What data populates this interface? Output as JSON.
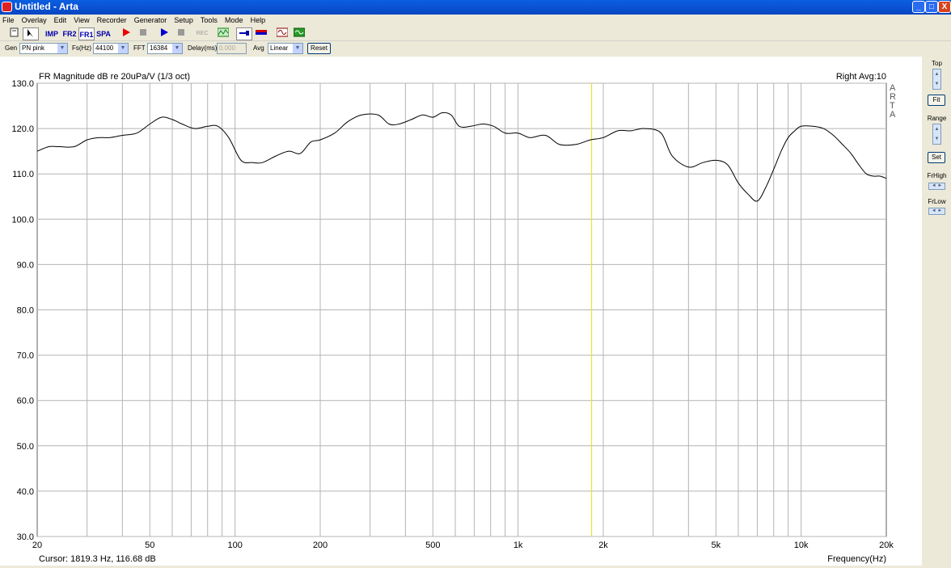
{
  "window": {
    "title": "Untitled - Arta",
    "minimize": "_",
    "maximize": "□",
    "close": "X"
  },
  "menu": [
    "File",
    "Overlay",
    "Edit",
    "View",
    "Recorder",
    "Generator",
    "Setup",
    "Tools",
    "Mode",
    "Help"
  ],
  "toolbar": {
    "imp": "IMP",
    "fr2": "FR2",
    "fr1": "FR1",
    "spa": "SPA",
    "rec": "REC"
  },
  "controls": {
    "gen_label": "Gen",
    "gen_value": "PN pink",
    "fs_label": "Fs(Hz)",
    "fs_value": "44100",
    "fft_label": "FFT",
    "fft_value": "16384",
    "delay_label": "Delay(ms)",
    "delay_value": "0.000",
    "avg_label": "Avg",
    "avg_value": "Linear",
    "reset": "Reset"
  },
  "graph": {
    "title": "FR Magnitude dB re 20uPa/V (1/3 oct)",
    "channel": "Right  Avg:10",
    "watermark": "ARTA",
    "cursor": "Cursor:  1819.3 Hz, 116.68 dB",
    "xlabel": "Frequency(Hz)",
    "line_color": "#000000",
    "cursor_color": "#e6e600",
    "grid_color": "#b4b4b4"
  },
  "rightpanel": {
    "top": "Top",
    "fit": "Fit",
    "range": "Range",
    "set": "Set",
    "frhigh": "FrHigh",
    "frlow": "FrLow"
  },
  "chart_data": {
    "type": "line",
    "x_scale": "log",
    "xlim": [
      20,
      20000
    ],
    "ylim": [
      30,
      130
    ],
    "yticks": [
      130,
      120,
      110,
      100,
      90,
      80,
      70,
      60,
      50,
      40,
      30
    ],
    "ytick_labels": [
      "130.0",
      "120.0",
      "110.0",
      "100.0",
      "90.0",
      "80.0",
      "70.0",
      "60.0",
      "50.0",
      "40.0",
      "30.0"
    ],
    "xtick_values": [
      20,
      50,
      100,
      200,
      500,
      1000,
      2000,
      5000,
      10000,
      20000
    ],
    "xtick_labels": [
      "20",
      "50",
      "100",
      "200",
      "500",
      "1k",
      "2k",
      "5k",
      "10k",
      "20k"
    ],
    "cursor_x": 1819.3,
    "series": [
      {
        "x": [
          20,
          22,
          24,
          27,
          30,
          33,
          36,
          40,
          45,
          50,
          55,
          60,
          65,
          72,
          80,
          87,
          95,
          105,
          115,
          125,
          140,
          155,
          170,
          185,
          200,
          225,
          250,
          280,
          320,
          350,
          380,
          420,
          460,
          500,
          540,
          580,
          620,
          680,
          750,
          820,
          900,
          1000,
          1100,
          1250,
          1400,
          1600,
          1800,
          2000,
          2250,
          2500,
          2800,
          3200,
          3500,
          4000,
          4500,
          5000,
          5500,
          6000,
          6500,
          7000,
          7500,
          8000,
          8500,
          9000,
          9500,
          10000,
          11000,
          12000,
          13000,
          14000,
          15000,
          16000,
          17000,
          18000,
          19000,
          20000
        ],
        "y": [
          115,
          116,
          116,
          116,
          117.5,
          118,
          118,
          118.5,
          119,
          121,
          122.5,
          122,
          121,
          120,
          120.5,
          120.5,
          118,
          113,
          112.5,
          112.5,
          114,
          115,
          114.5,
          117,
          117.5,
          119,
          121.5,
          123,
          123,
          121,
          121,
          122,
          123,
          122.5,
          123.5,
          123,
          120.5,
          120.5,
          121,
          120.5,
          119,
          119,
          118,
          118.5,
          116.5,
          116.5,
          117.5,
          118,
          119.5,
          119.5,
          120,
          119,
          114,
          111.5,
          112.5,
          113,
          112,
          108,
          105.5,
          104,
          107,
          111,
          115,
          118,
          119.5,
          120.5,
          120.5,
          120,
          118.5,
          116.5,
          114.5,
          112,
          110,
          109.5,
          109.5,
          109
        ]
      }
    ]
  }
}
